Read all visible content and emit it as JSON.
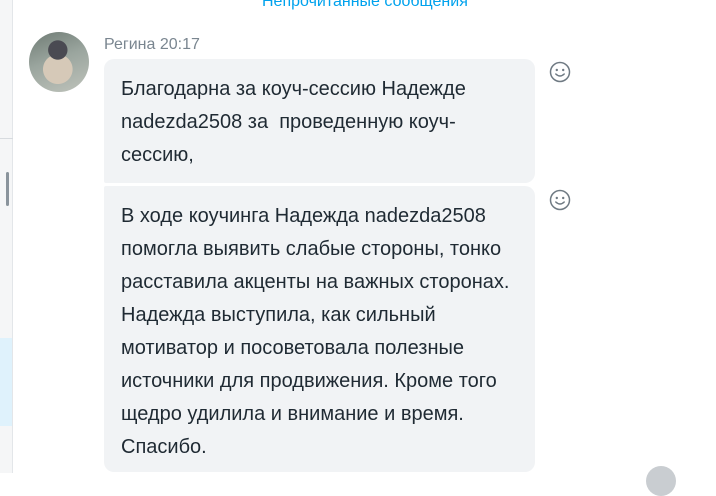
{
  "unread_link": "Непрочитанные сообщения",
  "message_group": {
    "sender": "Регина",
    "time": "20:17",
    "messages": [
      {
        "text": "Благодарна за коуч-сессию Надежде nadezda2508 за  проведенную коуч-сессию,"
      },
      {
        "text": "В ходе коучинга Надежда nadezda2508 помогла выявить слабые стороны, тонко расставила акценты на важных сторонах. Надежда выступила, как сильный мотиватор и посоветовала полезные источники для продвижения. Кроме того щедро удилила и внимание и время. Спасибо."
      }
    ]
  },
  "icons": {
    "reaction": "smiley-icon",
    "avatar": "user-avatar"
  },
  "colors": {
    "accent": "#00a2ed",
    "bubble": "#f1f3f5",
    "meta_text": "#7a8690"
  }
}
